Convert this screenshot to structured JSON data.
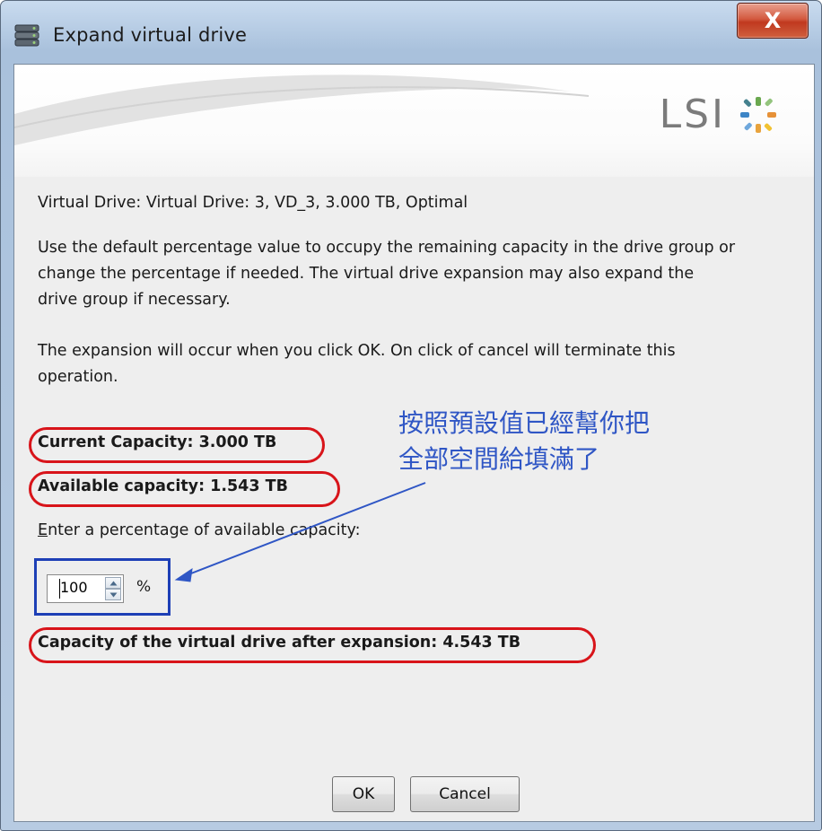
{
  "window": {
    "title": "Expand virtual drive",
    "close_label": "X"
  },
  "banner": {
    "logo_text": "LSI"
  },
  "content": {
    "virtual_drive_line": "Virtual Drive: Virtual Drive: 3, VD_3, 3.000 TB, Optimal",
    "instructions_line1": "Use the default percentage value to occupy the remaining capacity in the drive group or",
    "instructions_line2": "change the percentage if needed. The virtual drive expansion may also expand the",
    "instructions_line3": "drive group if necessary.",
    "expansion_line1": "The expansion will occur when you click OK. On click of cancel will terminate this",
    "expansion_line2": "operation.",
    "current_capacity": "Current Capacity: 3.000 TB",
    "available_capacity": "Available capacity: 1.543 TB",
    "percentage_prompt_mnemonic": "E",
    "percentage_prompt_rest": "nter a percentage of available capacity:",
    "percentage_value": "100",
    "percent_symbol": "%",
    "capacity_after": "Capacity of the virtual drive after expansion: 4.543 TB"
  },
  "annotation": {
    "line1": "按照預設值已經幫你把",
    "line2": "全部空間給填滿了",
    "highlight_color": "#d8141a",
    "note_color": "#2f56c5"
  },
  "buttons": {
    "ok_label": "OK",
    "cancel_label": "Cancel"
  }
}
